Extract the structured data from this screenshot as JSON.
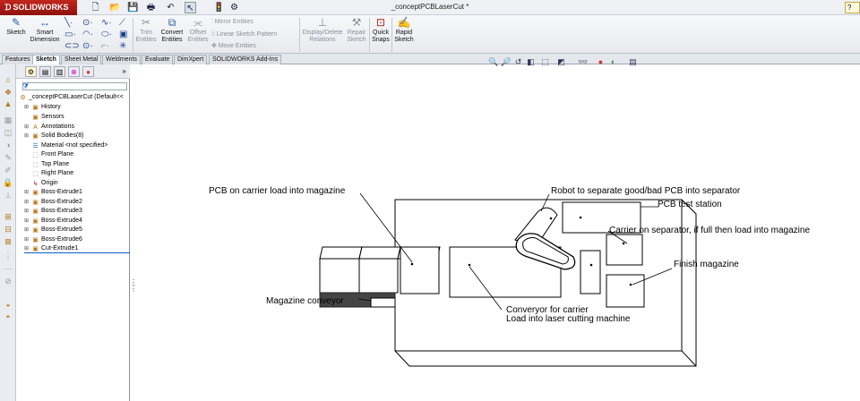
{
  "app": {
    "brand": "SOLIDWORKS",
    "document_title": "_conceptPCBLaserCut *"
  },
  "quick_access": [
    "new-doc-icon",
    "open-icon",
    "save-icon",
    "print-icon",
    "undo-icon",
    "select-icon",
    "rebuild-icon",
    "options-icon"
  ],
  "ribbon": {
    "sketch": "Sketch",
    "smart_dimension": [
      "Smart",
      "Dimension"
    ],
    "trim_entities": [
      "Trim",
      "Entities"
    ],
    "convert_entities": [
      "Convert",
      "Entities"
    ],
    "offset_entities": [
      "Offset",
      "Entities"
    ],
    "mirror_entities": "Mirror Entities",
    "linear_sketch_pattern": "Linear Sketch Pattern",
    "move_entities": "Move Entities",
    "display_delete_relations": [
      "Display/Delete",
      "Relations"
    ],
    "repair_sketch": [
      "Repair",
      "Sketch"
    ],
    "quick_snaps": [
      "Quick",
      "Snaps"
    ],
    "rapid_sketch": [
      "Rapid",
      "Sketch"
    ]
  },
  "tabs": [
    "Features",
    "Sketch",
    "Sheet Metal",
    "Weldments",
    "Evaluate",
    "DimXpert",
    "SOLIDWORKS Add-Ins"
  ],
  "active_tab": "Sketch",
  "tree": {
    "root": "_conceptPCBLaserCut  (Default<<",
    "items": [
      "History",
      "Sensors",
      "Annotations",
      "Solid Bodies(8)",
      "Material <not specified>",
      "Front Plane",
      "Top Plane",
      "Right Plane",
      "Origin",
      "Boss-Extrude1",
      "Boss-Extrude2",
      "Boss-Extrude3",
      "Boss-Extrude4",
      "Boss-Extrude5",
      "Boss-Extrude6",
      "Cut-Extrude1"
    ]
  },
  "annotations": {
    "pcb_load": "PCB on carrier load into magazine",
    "robot": "Robot to separate good/bad PCB into separator",
    "test_station": "PCB test station",
    "carrier_separator": "Carrier on separator, if full then load into magazine",
    "finish_magazine": "Finish magazine",
    "magazine_conveyor": "Magazine conveyor",
    "conveyor_carrier": "Converyor  for carrier",
    "load_laser": "Load into laser cutting machine"
  },
  "colors": {
    "brand_red": "#b01c15",
    "ribbon_bg": "#eef0f3",
    "tree_highlight": "#0a5fc4"
  }
}
